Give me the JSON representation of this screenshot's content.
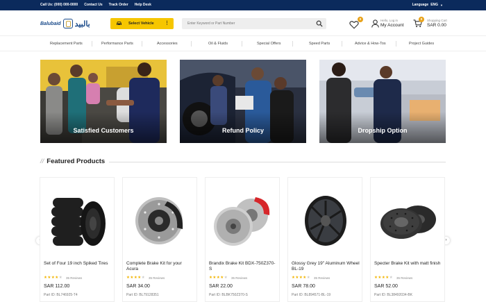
{
  "topbar": {
    "links": [
      "Call Us: (000) 000-0000",
      "Contact Us",
      "Track Order",
      "Help Desk"
    ],
    "language_label": "Language",
    "language_value": "ENG"
  },
  "header": {
    "logo_en": "Balubaid",
    "logo_ar": "بالبيد",
    "vehicle_button": "Select Vehicle",
    "search_placeholder": "Enter Keyword or Part Number",
    "wishlist_count": "0",
    "account_small": "Hello, Log in",
    "account_big": "My Account",
    "cart_count": "0",
    "cart_small": "Shopping Cart",
    "cart_total": "SAR 0.00"
  },
  "nav": [
    "Replacement Parts",
    "Performance Parts",
    "Accessories",
    "Oil & Fluids",
    "Special Offers",
    "Speed Parts",
    "Advice & How-Tos",
    "Project Guides"
  ],
  "banners": [
    "Satisfied Customers",
    "Refund Policy",
    "Dropship Option"
  ],
  "featured": {
    "title": "Featured Products",
    "products": [
      {
        "name": "Set of Four 19 inch Spiked Tires",
        "rating": 4,
        "reviews": "35 Reviews",
        "price": "SAR 112.00",
        "part_id": "Part ID: BL746925-T4"
      },
      {
        "name": "Complete Brake Kit for your Acura",
        "rating": 4,
        "reviews": "35 Reviews",
        "price": "SAR 34.00",
        "part_id": "Part ID: BL79128351"
      },
      {
        "name": "Brandix Brake Kit BDX-750Z370-S",
        "rating": 4,
        "reviews": "35 Reviews",
        "price": "SAR 22.00",
        "part_id": "Part ID: BLBK750Z370-S"
      },
      {
        "name": "Glossy Grey 19\" Aluminum Wheel BL-19",
        "rating": 4,
        "reviews": "35 Reviews",
        "price": "SAR 78.00",
        "part_id": "Part ID: BL894571-BL-19"
      },
      {
        "name": "Specter Brake Kit with matt finish",
        "rating": 4,
        "reviews": "35 Reviews",
        "price": "SAR 52.00",
        "part_id": "Part ID: BL38492034-BK"
      }
    ]
  },
  "colors": {
    "topbar": "#0b2a5c",
    "accent": "#f6c600",
    "badge": "#e8a21a",
    "star": "#f2b400"
  },
  "icons": [
    "car-icon",
    "search-icon",
    "heart-icon",
    "user-icon",
    "cart-icon",
    "chevron-left-icon",
    "chevron-right-icon"
  ]
}
